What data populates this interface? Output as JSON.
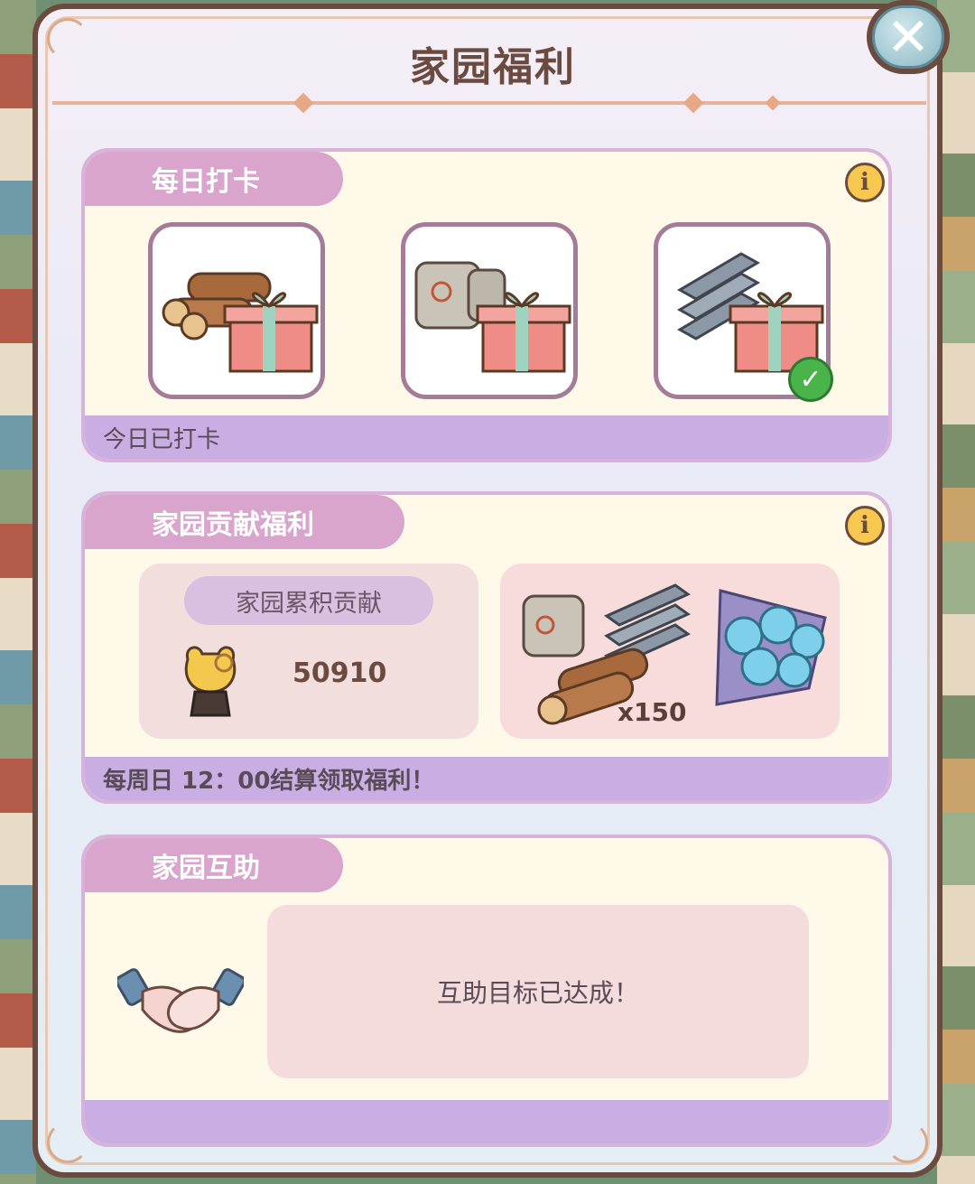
{
  "window": {
    "title": "家园福利"
  },
  "daily_checkin": {
    "title": "每日打卡",
    "rewards": [
      {
        "item": "wood-logs",
        "checked": false
      },
      {
        "item": "cement-bags",
        "checked": false
      },
      {
        "item": "steel-beams",
        "checked": true
      }
    ],
    "status": "今日已打卡"
  },
  "contribution": {
    "title": "家园贡献福利",
    "label": "家园累积贡献",
    "value": "50910",
    "reward_quantity": "x150",
    "footer": "每周日 12：00结算领取福利！"
  },
  "mutual_help": {
    "title": "家园互助",
    "message": "互助目标已达成！"
  },
  "colors": {
    "panel_border": "#6b4a3f",
    "tab_pink": "#d9a5cc",
    "footer_lavender": "#c9aee3",
    "card_bg": "#fff9ea"
  }
}
